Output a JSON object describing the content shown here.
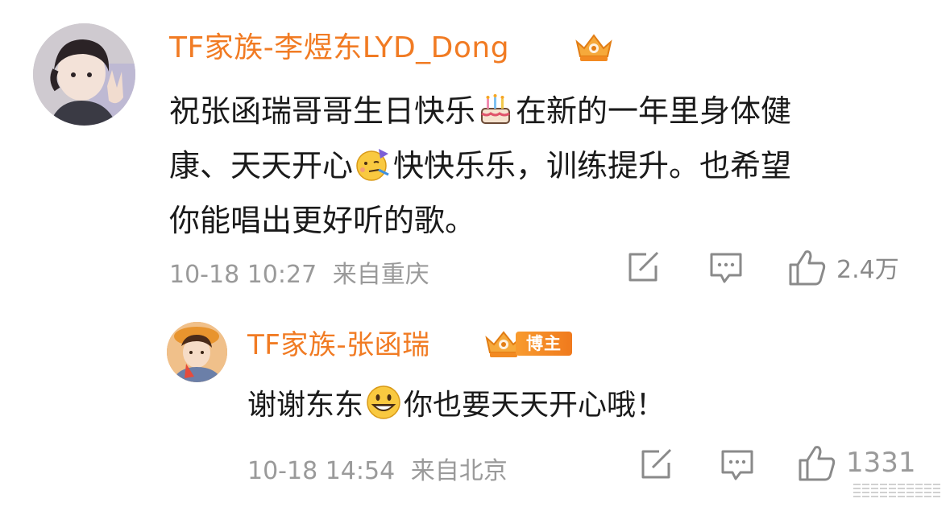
{
  "comment": {
    "username": "TF家族-李煜东LYD_Dong",
    "text_line1_a": "祝张函瑞哥哥生日快乐",
    "text_line1_b": "在新的一年里身体健",
    "text_line2_a": "康、天天开心",
    "text_line2_b": "快快乐乐，训练提升。也希望",
    "text_line3": "你能唱出更好听的歌。",
    "emoji_1": "cake-emoji",
    "emoji_2": "party-face-emoji",
    "timestamp": "10-18 10:27",
    "location": "来自重庆",
    "like_count": "2.4万"
  },
  "reply": {
    "username": "TF家族-张函瑞",
    "badge": "博主",
    "text_a": "谢谢东东",
    "text_b": "你也要天天开心哦！",
    "emoji": "grinning-face-emoji",
    "timestamp": "10-18 14:54",
    "location": "来自北京",
    "like_count": "1331"
  },
  "colors": {
    "username": "#f17b23",
    "meta": "#9a9a9a",
    "badge_bg": "#f07a1d"
  },
  "icons": {
    "share": "share-icon",
    "comment": "comment-icon",
    "like": "thumbs-up-icon",
    "crown": "crown-badge-icon"
  }
}
